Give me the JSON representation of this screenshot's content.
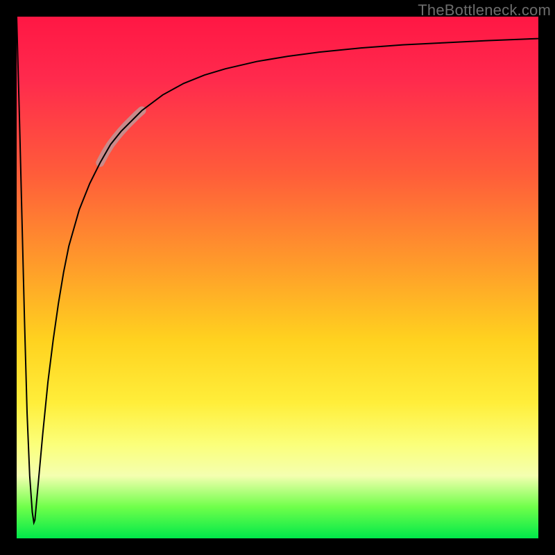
{
  "watermark": "TheBottleneck.com",
  "chart_data": {
    "type": "line",
    "title": "",
    "xlabel": "",
    "ylabel": "",
    "xlim": [
      0,
      100
    ],
    "ylim": [
      0,
      100
    ],
    "grid": false,
    "legend": false,
    "background_gradient": {
      "orientation": "vertical",
      "stops": [
        {
          "pos": 0.0,
          "color": "#ff1744"
        },
        {
          "pos": 0.12,
          "color": "#ff2a4d"
        },
        {
          "pos": 0.3,
          "color": "#ff5c3a"
        },
        {
          "pos": 0.48,
          "color": "#ff9d2a"
        },
        {
          "pos": 0.62,
          "color": "#ffd21f"
        },
        {
          "pos": 0.74,
          "color": "#ffee3a"
        },
        {
          "pos": 0.82,
          "color": "#fbff7a"
        },
        {
          "pos": 0.88,
          "color": "#f4ffb0"
        },
        {
          "pos": 0.94,
          "color": "#6fff4a"
        },
        {
          "pos": 1.0,
          "color": "#00e84a"
        }
      ]
    },
    "series": [
      {
        "name": "bottleneck-curve",
        "color": "#000000",
        "stroke_width": 2,
        "x": [
          0.0,
          0.5,
          1.0,
          1.5,
          2.0,
          2.5,
          3.0,
          3.3,
          3.5,
          4.0,
          5.0,
          6.0,
          7.0,
          8.0,
          9.0,
          10.0,
          12.0,
          14.0,
          16.0,
          18.0,
          20.0,
          24.0,
          28.0,
          32.0,
          36.0,
          40.0,
          46.0,
          52.0,
          58.0,
          66.0,
          74.0,
          82.0,
          90.0,
          100.0
        ],
        "y": [
          100.0,
          82.0,
          62.0,
          42.0,
          24.0,
          12.0,
          5.0,
          3.0,
          3.5,
          9.0,
          20.0,
          30.0,
          38.0,
          45.0,
          51.0,
          56.0,
          63.0,
          68.0,
          72.0,
          75.5,
          78.0,
          82.0,
          85.0,
          87.2,
          88.8,
          90.0,
          91.4,
          92.4,
          93.2,
          94.0,
          94.6,
          95.0,
          95.4,
          95.8
        ]
      },
      {
        "name": "highlight-segment",
        "color": "#c98a8a",
        "stroke_width": 12,
        "linecap": "round",
        "x": [
          16.0,
          17.0,
          18.0,
          19.0,
          20.0,
          21.0,
          22.0,
          23.0,
          24.0
        ],
        "y": [
          72.0,
          73.9,
          75.5,
          76.8,
          78.0,
          79.1,
          80.1,
          81.1,
          82.0
        ]
      }
    ]
  }
}
